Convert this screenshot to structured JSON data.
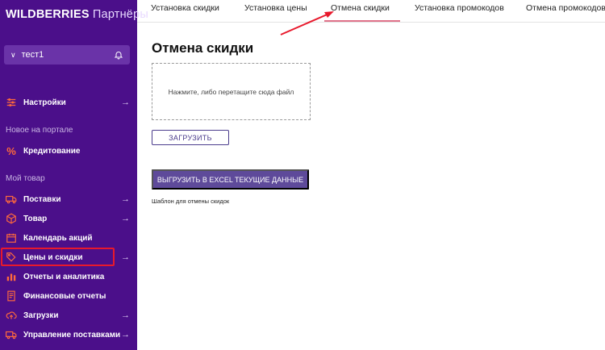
{
  "brand": {
    "name_bold": "WILDBERRIES",
    "name_rest": " Партнёры"
  },
  "user": {
    "name": "тест1"
  },
  "sidebar": {
    "sections": [
      "Новое на портале",
      "Мой товар"
    ],
    "items": [
      {
        "label": "Настройки",
        "icon": "settings-sliders-icon",
        "arrow": "→"
      },
      {
        "label": "Кредитование",
        "icon": "percent-icon",
        "arrow": ""
      },
      {
        "label": "Поставки",
        "icon": "truck-icon",
        "arrow": "→"
      },
      {
        "label": "Товар",
        "icon": "box-icon",
        "arrow": "→"
      },
      {
        "label": "Календарь акций",
        "icon": "calendar-icon",
        "arrow": ""
      },
      {
        "label": "Цены и скидки",
        "icon": "price-tag-icon",
        "arrow": "→"
      },
      {
        "label": "Отчеты и аналитика",
        "icon": "bar-chart-icon",
        "arrow": ""
      },
      {
        "label": "Финансовые отчеты",
        "icon": "document-icon",
        "arrow": ""
      },
      {
        "label": "Загрузки",
        "icon": "cloud-upload-icon",
        "arrow": "→"
      },
      {
        "label": "Управление поставками",
        "icon": "truck-manage-icon",
        "arrow": "→"
      }
    ]
  },
  "tabs": [
    "Установка скидки",
    "Установка цены",
    "Отмена скидки",
    "Установка промокодов",
    "Отмена промокодов"
  ],
  "active_tab": "Отмена скидки",
  "main": {
    "title": "Отмена скидки",
    "dropzone_text": "Нажмите, либо перетащите сюда файл",
    "upload_label": "ЗАГРУЗИТЬ",
    "export_label": "ВЫГРУЗИТЬ В EXCEL ТЕКУЩИЕ ДАННЫЕ",
    "template_link": "Шаблон для отмены скидок"
  },
  "colors": {
    "sidebar_bg": "#4b0f8a",
    "accent_icon": "#ff6a3c",
    "highlight": "#e8192c",
    "button_primary": "#5e4a9a"
  }
}
